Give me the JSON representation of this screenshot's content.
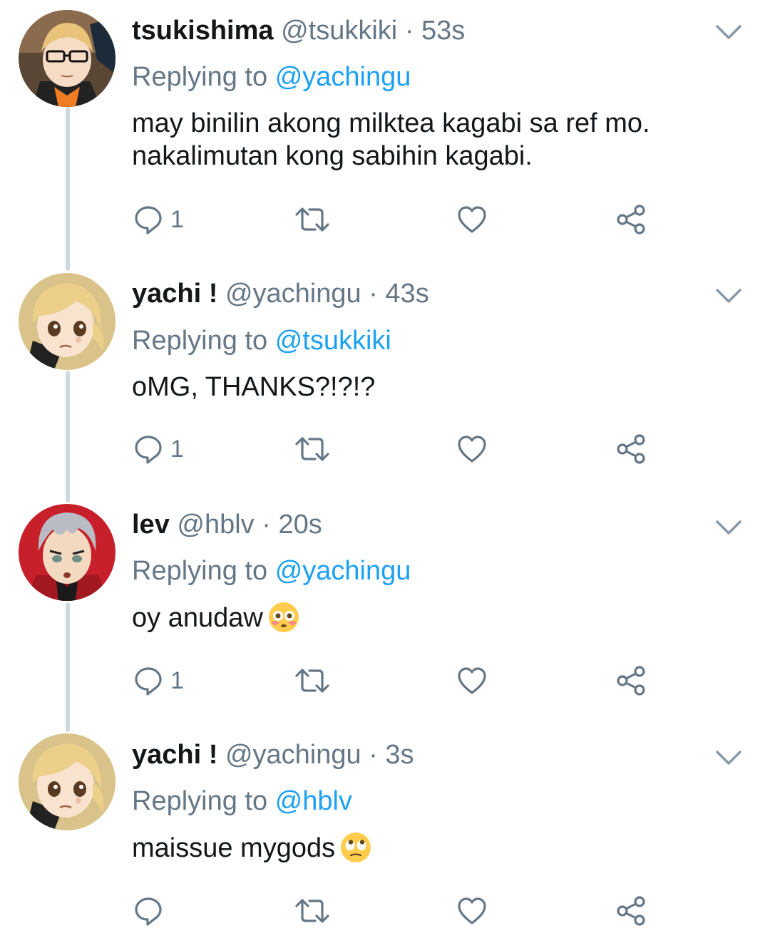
{
  "tweets": [
    {
      "display_name": "tsukishima",
      "handle": "@tsukkiki",
      "separator": "·",
      "time": "53s",
      "replying_prefix": "Replying to",
      "replying_to": "@yachingu",
      "lines": [
        "may binilin akong milktea kagabi sa ref mo.",
        "nakalimutan kong sabihin kagabi."
      ],
      "reply_count": "1",
      "avatar": "tsukishima-avatar"
    },
    {
      "display_name": "yachi !",
      "handle": "@yachingu",
      "separator": "·",
      "time": "43s",
      "replying_prefix": "Replying to",
      "replying_to": "@tsukkiki",
      "lines": [
        "oMG, THANKS?!?!?"
      ],
      "reply_count": "1",
      "avatar": "yachi-avatar"
    },
    {
      "display_name": "lev",
      "handle": "@hblv",
      "separator": "·",
      "time": "20s",
      "replying_prefix": "Replying to",
      "replying_to": "@yachingu",
      "lines": [
        "oy anudaw"
      ],
      "emoji": "flushed-face-emoji",
      "reply_count": "1",
      "avatar": "lev-avatar"
    },
    {
      "display_name": "yachi !",
      "handle": "@yachingu",
      "separator": "·",
      "time": "3s",
      "replying_prefix": "Replying to",
      "replying_to": "@hblv",
      "lines": [
        "maissue mygods"
      ],
      "emoji": "rolling-eyes-emoji",
      "reply_count": "",
      "avatar": "yachi-avatar"
    }
  ],
  "icons": {
    "reply": "reply-icon",
    "retweet": "retweet-icon",
    "like": "heart-icon",
    "share": "share-icon",
    "more": "chevron-down-icon"
  },
  "colors": {
    "text": "#14171a",
    "secondary": "#657786",
    "accent": "#1da1f2",
    "thread_line": "#cfd9de"
  }
}
